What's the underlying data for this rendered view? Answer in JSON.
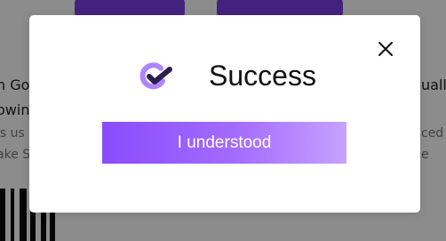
{
  "background": {
    "text_fragments": {
      "left_line_1": "n Go",
      "left_line_2": "owin",
      "left_line_3": "is us",
      "left_line_4": "ake S",
      "right_line_1": "ually",
      "right_line_3": "ced",
      "right_line_4": "e"
    }
  },
  "modal": {
    "title": "Success",
    "brand_icon": "check-circle-logo-icon",
    "close_icon": "close-icon",
    "primary_button_label": "I understood"
  },
  "colors": {
    "brand_purple": "#7a3fe6",
    "button_gradient_start": "#8a4cfb",
    "button_gradient_end": "#c7a2ff",
    "logo_light": "#b084ff",
    "logo_dark": "#2a1f4d"
  }
}
